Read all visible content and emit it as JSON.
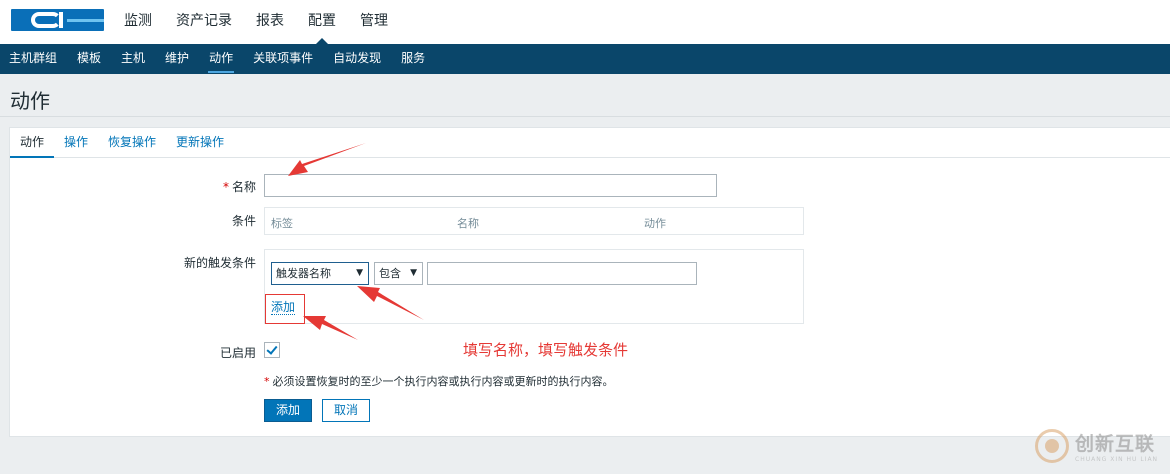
{
  "main_nav": [
    "监测",
    "资产记录",
    "报表",
    "配置",
    "管理"
  ],
  "main_nav_active": 3,
  "sub_nav": [
    "主机群组",
    "模板",
    "主机",
    "维护",
    "动作",
    "关联项事件",
    "自动发现",
    "服务"
  ],
  "sub_nav_active": 4,
  "page_title": "动作",
  "tabs": [
    "动作",
    "操作",
    "恢复操作",
    "更新操作"
  ],
  "form": {
    "name_label": "名称",
    "name_value": "",
    "conditions_label": "条件",
    "conditions_columns": [
      "标签",
      "名称",
      "动作"
    ],
    "new_condition_label": "新的触发条件",
    "condition_type": "触发器名称",
    "condition_operator": "包含",
    "condition_value": "",
    "add_condition_link": "添加",
    "enabled_label": "已启用",
    "enabled": true,
    "note": "必须设置恢复时的至少一个执行内容或执行内容或更新时的执行内容。",
    "add_button": "添加",
    "cancel_button": "取消"
  },
  "annotation": "填写名称，填写触发条件",
  "colors": {
    "subnav_bg": "#0a466a",
    "accent": "#0275b8",
    "annotation_red": "#e53935"
  },
  "watermark": {
    "text": "创新互联",
    "subtext": "CHUANG XIN HU LIAN"
  }
}
